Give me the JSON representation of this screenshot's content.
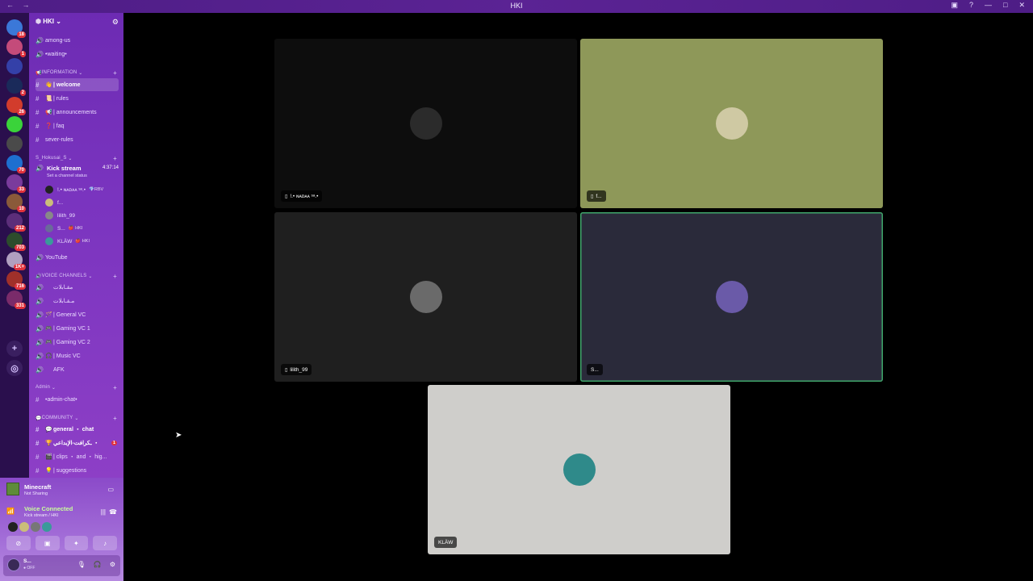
{
  "window": {
    "title": "HKI",
    "nav": "← →"
  },
  "guilds": [
    {
      "icon": "user-avatar-icon",
      "color": "#3b78d8",
      "badge": "18"
    },
    {
      "icon": "server-icon",
      "color": "#c44b7a",
      "badge": "1"
    },
    {
      "icon": "folder-icon",
      "color": "#3440a8",
      "badge": ""
    },
    {
      "icon": "server-icon",
      "color": "#1a2a5a",
      "badge": "2"
    },
    {
      "icon": "server-icon",
      "color": "#d23c2c",
      "badge": "26"
    },
    {
      "icon": "server-icon",
      "color": "#3ad33a",
      "badge": ""
    },
    {
      "icon": "server-icon",
      "color": "#4a4a4a",
      "badge": ""
    },
    {
      "icon": "server-icon",
      "color": "#1e6fd0",
      "badge": "70"
    },
    {
      "icon": "server-icon",
      "color": "#7a3b9c",
      "badge": "33"
    },
    {
      "icon": "server-icon",
      "color": "#8a5a3a",
      "badge": "10"
    },
    {
      "icon": "server-icon",
      "color": "#5c2e7a",
      "badge": "212"
    },
    {
      "icon": "server-icon",
      "color": "#2c4c2c",
      "badge": "703"
    },
    {
      "icon": "server-icon",
      "color": "#b0a0c0",
      "badge": "1K+"
    },
    {
      "icon": "server-icon",
      "color": "#a0302a",
      "badge": "716"
    },
    {
      "icon": "server-icon",
      "color": "#7a2b6a",
      "badge": "331"
    }
  ],
  "server": {
    "name": "HKI ⌄",
    "top_channels": [
      {
        "label": "among-us",
        "icon": "speaker-icon"
      },
      {
        "label": "•waiting•",
        "icon": "speaker-icon"
      }
    ],
    "information": {
      "header": "INFORMATION",
      "channels": [
        {
          "label": "| welcome",
          "emoji": "👋",
          "active": true
        },
        {
          "label": "| rules",
          "emoji": "📜"
        },
        {
          "label": "| announcements",
          "emoji": "📢"
        },
        {
          "label": "| faq",
          "emoji": "❓"
        },
        {
          "label": "sever-rules",
          "emoji": ""
        }
      ]
    },
    "hokusai": {
      "header": "S_Hokusai_S",
      "stream": {
        "name": "Kick stream",
        "time": "4:37:14",
        "status": "Set a channel status"
      },
      "users": [
        {
          "name": "!.• ɴᴀᴅᴀᴀ ˢᵃ.•",
          "tag": "💎RBV",
          "color": "#222"
        },
        {
          "name": "f...",
          "tag": "",
          "color": "#cbbd7a"
        },
        {
          "name": "lilith_99",
          "tag": "",
          "color": "#888"
        },
        {
          "name": "S...",
          "tag": "🍎 HKI",
          "color": "#6a6a9a"
        },
        {
          "name": "KLÄW",
          "tag": "🍎 HKI",
          "color": "#3a9a9a"
        }
      ],
      "after": {
        "label": "YouTube",
        "icon": "speaker-icon"
      }
    },
    "voice": {
      "header": "VOICE CHANNELS",
      "channels": [
        {
          "label": "مقـابلات",
          "emoji": ""
        },
        {
          "label": "مـقـابلات",
          "emoji": ""
        },
        {
          "label": "| General VC",
          "emoji": "🪄"
        },
        {
          "label": "| Gaming VC 1",
          "emoji": "🎮"
        },
        {
          "label": "| Gaming VC 2",
          "emoji": "🎮"
        },
        {
          "label": "| Music VC",
          "emoji": "🎧"
        },
        {
          "label": "AFK",
          "emoji": ""
        }
      ]
    },
    "admin": {
      "header": "Admin",
      "channels": [
        {
          "label": "•admin-chat•"
        }
      ]
    },
    "community": {
      "header": "COMMUNITY",
      "channels": [
        {
          "label": "general ・ chat",
          "emoji": "💬"
        },
        {
          "label": "ـكرافت-الإبداعي ・",
          "emoji": "🏆",
          "badge": "1"
        },
        {
          "label": "| clips ・ and ・ hig...",
          "emoji": "🎬"
        },
        {
          "label": "| suggestions",
          "emoji": "💡"
        }
      ]
    }
  },
  "panel": {
    "activity": {
      "title": "Minecraft",
      "sub": "Not Sharing"
    },
    "voice": {
      "title": "Voice Connected",
      "sub": "Kick stream / HKI"
    },
    "user": {
      "name": "S...",
      "status": "● OFF"
    }
  },
  "tiles": [
    {
      "label": "!.• ɴᴀᴅᴀᴀ ˢᵃ.•",
      "bg": "#0d0d0d",
      "avatar": "#2b2b2b",
      "phone": true,
      "speaking": false
    },
    {
      "label": "f...",
      "bg": "#8e9859",
      "avatar": "#cfc9a3",
      "phone": true,
      "speaking": false
    },
    {
      "label": "lilith_99",
      "bg": "#1f1f1f",
      "avatar": "#6a6a6a",
      "phone": true,
      "speaking": false
    },
    {
      "label": "S...",
      "bg": "#2a2a3a",
      "avatar": "#6a5aa8",
      "phone": false,
      "speaking": true
    },
    {
      "label": "KLÄW",
      "bg": "#cfcecb",
      "avatar": "#2f8a8a",
      "phone": false,
      "speaking": false
    }
  ]
}
